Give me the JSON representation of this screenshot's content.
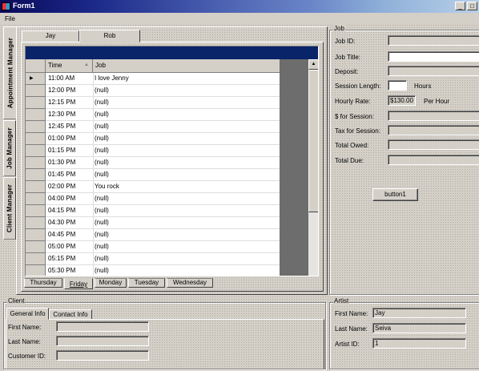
{
  "window": {
    "title": "Form1"
  },
  "menu": {
    "file": "File"
  },
  "side_tabs": [
    "Appointment Manager",
    "Job Manager",
    "Client Manager"
  ],
  "artist_tabs": [
    "Jay",
    "Rob"
  ],
  "grid": {
    "headers": {
      "time": "Time",
      "job": "Job"
    },
    "rows": [
      {
        "time": "11:00 AM",
        "job": "I love Jenny"
      },
      {
        "time": "12:00 PM",
        "job": "(null)"
      },
      {
        "time": "12:15 PM",
        "job": "(null)"
      },
      {
        "time": "12:30 PM",
        "job": "(null)"
      },
      {
        "time": "12:45 PM",
        "job": "(null)"
      },
      {
        "time": "01:00 PM",
        "job": "(null)"
      },
      {
        "time": "01:15 PM",
        "job": "(null)"
      },
      {
        "time": "01:30 PM",
        "job": "(null)"
      },
      {
        "time": "01:45 PM",
        "job": "(null)"
      },
      {
        "time": "02:00 PM",
        "job": "You rock"
      },
      {
        "time": "04:00 PM",
        "job": "(null)"
      },
      {
        "time": "04:15 PM",
        "job": "(null)"
      },
      {
        "time": "04:30 PM",
        "job": "(null)"
      },
      {
        "time": "04:45 PM",
        "job": "(null)"
      },
      {
        "time": "05:00 PM",
        "job": "(null)"
      },
      {
        "time": "05:15 PM",
        "job": "(null)"
      },
      {
        "time": "05:30 PM",
        "job": "(null)"
      }
    ]
  },
  "day_tabs": [
    "Thursday",
    "Friday",
    "Monday",
    "Tuesday",
    "Wednesday"
  ],
  "job": {
    "group_title": "Job",
    "job_id_label": "Job ID:",
    "job_title_label": "Job Title:",
    "deposit_label": "Deposit:",
    "session_length_label": "Session Length:",
    "hours_label": "Hours",
    "hourly_rate_label": "Hourly Rate:",
    "hourly_rate_value": "$130.00",
    "per_hour_label": "Per Hour",
    "for_session_label": "$ for Session:",
    "tax_label": "Tax for Session:",
    "total_owed_label": "Total Owed:",
    "total_due_label": "Total Due:",
    "button_label": "button1"
  },
  "client": {
    "group_title": "Client",
    "tabs": [
      "General Info",
      "Contact Info"
    ],
    "first_name_label": "First Name:",
    "last_name_label": "Last Name:",
    "customer_id_label": "Customer ID:"
  },
  "artist": {
    "group_title": "Artist",
    "first_name_label": "First Name:",
    "first_name_value": "Jay",
    "last_name_label": "Last Name:",
    "last_name_value": "Seiva",
    "artist_id_label": "Artist ID:",
    "artist_id_value": "1"
  }
}
